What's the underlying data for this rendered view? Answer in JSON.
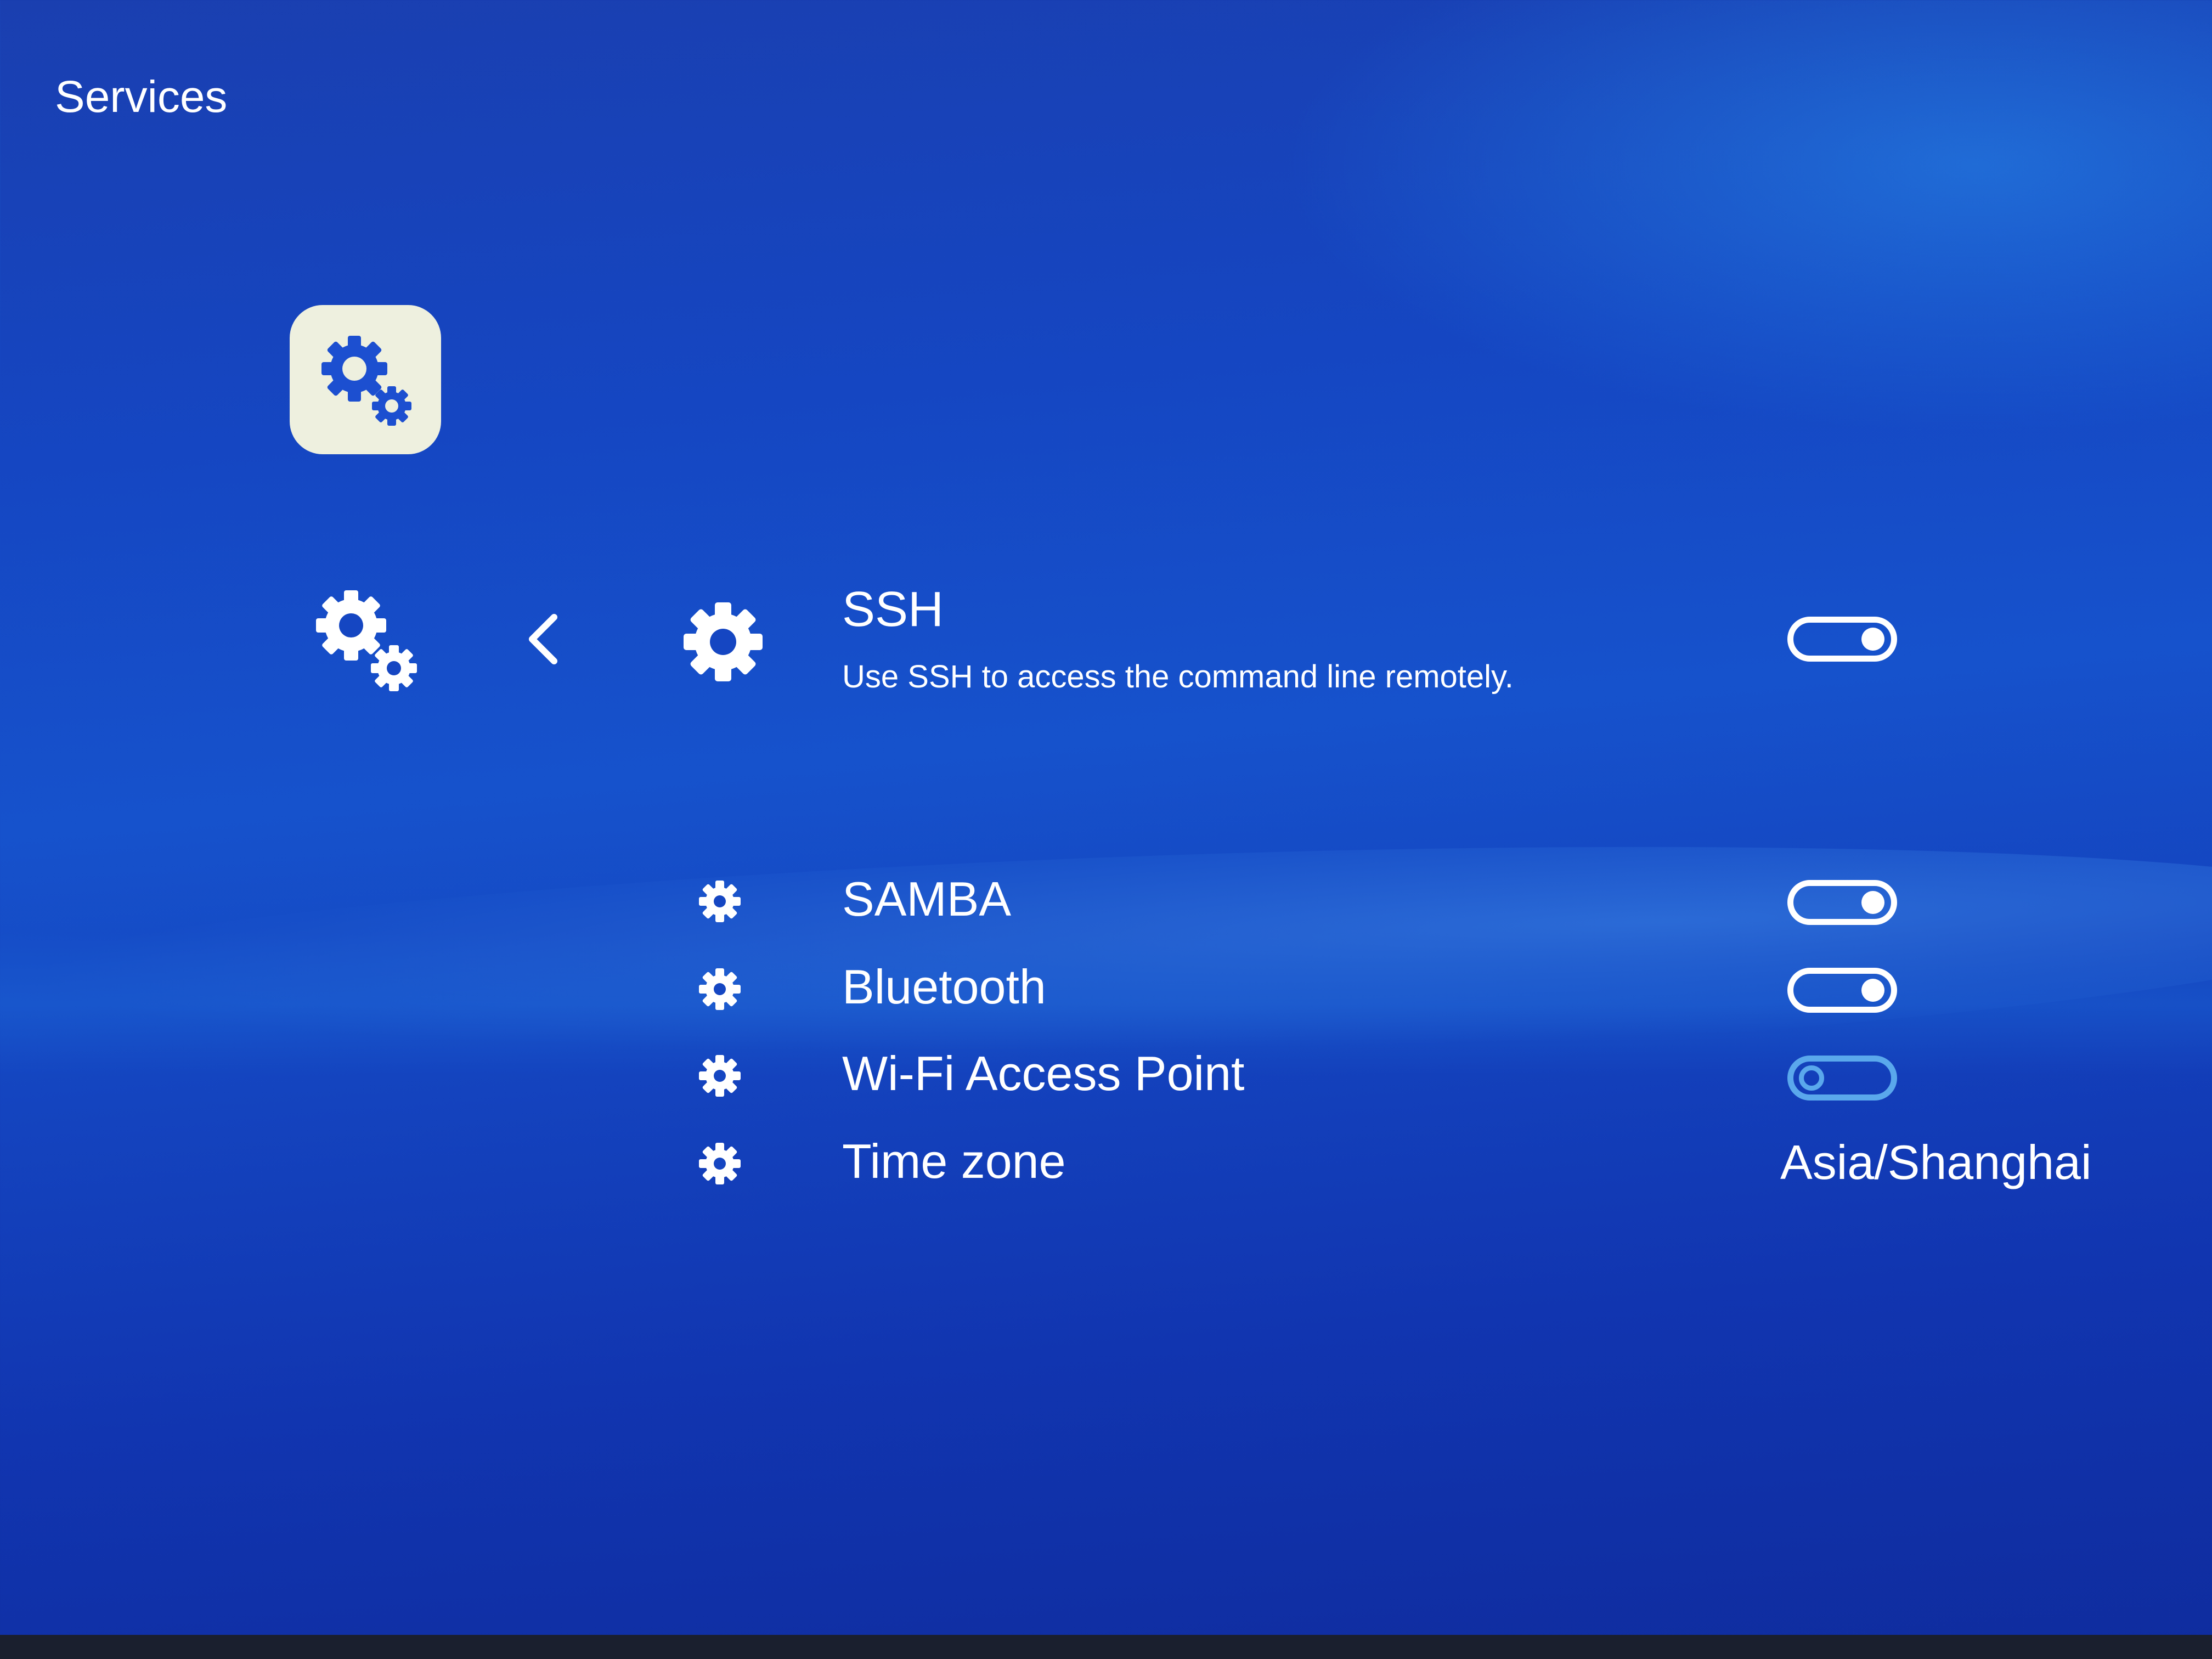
{
  "header": {
    "title": "Services"
  },
  "app_tile": {
    "icon": "gears-icon"
  },
  "nav": {
    "category_icon": "gears-icon",
    "back_icon": "chevron-left-icon"
  },
  "selected": {
    "icon": "gear-icon",
    "title": "SSH",
    "description": "Use SSH to access the command line remotely.",
    "enabled": true
  },
  "items": [
    {
      "label": "SAMBA",
      "icon": "gear-icon",
      "type": "toggle",
      "enabled": true
    },
    {
      "label": "Bluetooth",
      "icon": "gear-icon",
      "type": "toggle",
      "enabled": true
    },
    {
      "label": "Wi-Fi Access Point",
      "icon": "gear-icon",
      "type": "toggle",
      "enabled": false
    },
    {
      "label": "Time zone",
      "icon": "gear-icon",
      "type": "value",
      "value": "Asia/Shanghai"
    }
  ],
  "colors": {
    "background": "#1546c2",
    "text": "#ffffff",
    "tile": "#eef0df",
    "tile_icon": "#1c4fd0",
    "toggle_off": "#5aa8ec"
  }
}
